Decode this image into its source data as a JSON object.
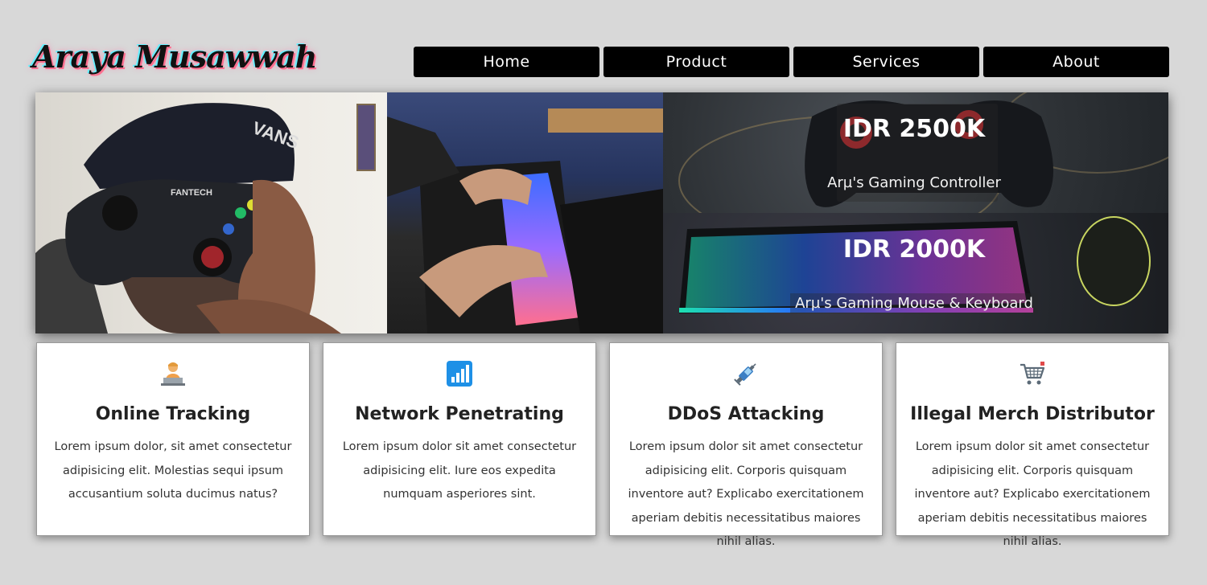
{
  "brand": {
    "logo_text": "Araya Musawwah"
  },
  "nav": {
    "items": [
      "Home",
      "Product",
      "Services",
      "About"
    ]
  },
  "hero": {
    "banners": [
      {
        "price": "IDR 2500K",
        "caption": "Arµ's Gaming Controller"
      },
      {
        "price": "IDR 2000K",
        "caption": "Arµ's Gaming Mouse & Keyboard"
      }
    ]
  },
  "services": [
    {
      "icon": "person-at-laptop-icon",
      "title": "Online Tracking",
      "text": "Lorem ipsum dolor, sit amet consectetur adipisicing elit. Molestias sequi ipsum accusantium soluta ducimus natus?"
    },
    {
      "icon": "signal-bars-icon",
      "title": "Network Penetrating",
      "text": "Lorem ipsum dolor sit amet consectetur adipisicing elit. Iure eos expedita numquam asperiores sint."
    },
    {
      "icon": "syringe-icon",
      "title": "DDoS Attacking",
      "text": "Lorem ipsum dolor sit amet consectetur adipisicing elit. Corporis quisquam inventore aut? Explicabo exercitationem aperiam debitis necessitatibus maiores nihil alias."
    },
    {
      "icon": "shopping-cart-icon",
      "title": "Illegal Merch Distributor",
      "text": "Lorem ipsum dolor sit amet consectetur adipisicing elit. Corporis quisquam inventore aut? Explicabo exercitationem aperiam debitis necessitatibus maiores nihil alias."
    }
  ],
  "colors": {
    "page_bg": "#d8d8d8",
    "nav_bg": "#000000",
    "card_bg": "#ffffff",
    "accent_blue": "#1e90e6"
  }
}
